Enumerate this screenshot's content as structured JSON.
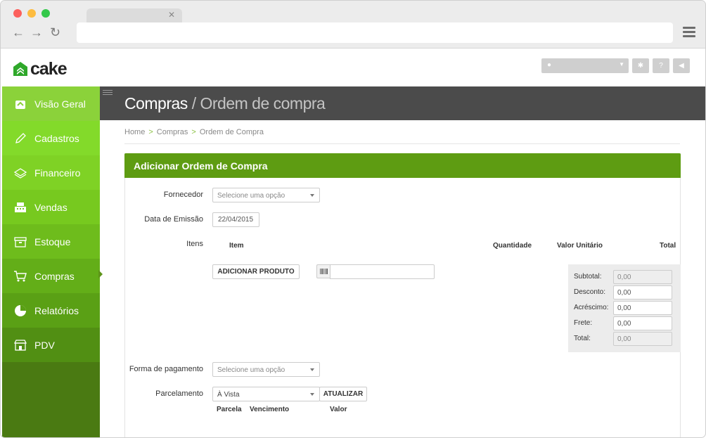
{
  "app": {
    "logo_text": "cake",
    "header_title": "Compras",
    "header_subtitle": "/ Ordem de compra"
  },
  "breadcrumb": [
    "Home",
    "Compras",
    "Ordem de Compra"
  ],
  "sidebar": {
    "items": [
      {
        "label": "Visão Geral",
        "icon": "home-icon",
        "color": "#8bd23a"
      },
      {
        "label": "Cadastros",
        "icon": "pencil-icon",
        "color": "#83da2a"
      },
      {
        "label": "Financeiro",
        "icon": "money-icon",
        "color": "#7fd225"
      },
      {
        "label": "Vendas",
        "icon": "cash-register-icon",
        "color": "#77c91f"
      },
      {
        "label": "Estoque",
        "icon": "box-icon",
        "color": "#6ebc1c"
      },
      {
        "label": "Compras",
        "icon": "cart-icon",
        "color": "#63ae18",
        "active": true
      },
      {
        "label": "Relatórios",
        "icon": "chart-icon",
        "color": "#5aa015"
      },
      {
        "label": "PDV",
        "icon": "store-icon",
        "color": "#518f13"
      }
    ]
  },
  "form": {
    "title": "Adicionar Ordem de Compra",
    "fornecedor_label": "Fornecedor",
    "fornecedor_placeholder": "Selecione uma opção",
    "data_label": "Data de Emissão",
    "data_value": "22/04/2015",
    "itens_label": "Itens",
    "columns": [
      "Item",
      "Quantidade",
      "Valor Unitário",
      "Total"
    ],
    "add_product_button": "ADICIONAR PRODUTO",
    "totals": [
      {
        "label": "Subtotal:",
        "value": "0,00",
        "readonly": true
      },
      {
        "label": "Desconto:",
        "value": "0,00",
        "readonly": false
      },
      {
        "label": "Acréscimo:",
        "value": "0,00",
        "readonly": false
      },
      {
        "label": "Frete:",
        "value": "0,00",
        "readonly": false
      },
      {
        "label": "Total:",
        "value": "0,00",
        "readonly": true
      }
    ],
    "pagamento_label": "Forma de pagamento",
    "pagamento_placeholder": "Selecione uma opção",
    "parcelamento_label": "Parcelamento",
    "parcelamento_value": "À Vista",
    "update_button": "ATUALIZAR",
    "parcel_columns": [
      "Parcela",
      "Vencimento",
      "Valor"
    ]
  },
  "colors": {
    "accent": "#5e9c12",
    "header_bg": "#4b4b4b"
  }
}
